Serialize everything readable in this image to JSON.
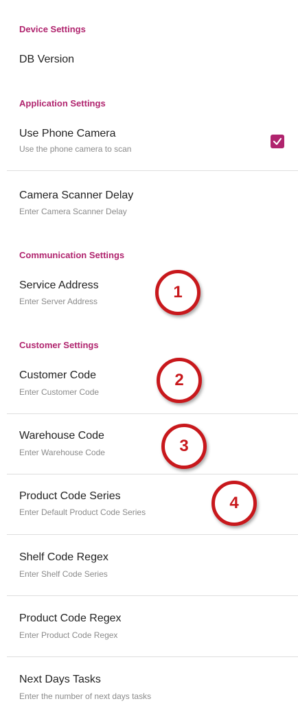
{
  "sections": {
    "device": "Device Settings",
    "application": "Application Settings",
    "communication": "Communication Settings",
    "customer": "Customer Settings"
  },
  "prefs": {
    "db_version": {
      "title": "DB Version"
    },
    "use_phone_camera": {
      "title": "Use Phone Camera",
      "summary": "Use the phone camera to scan",
      "checked": true
    },
    "camera_scanner_delay": {
      "title": "Camera Scanner Delay",
      "summary": "Enter Camera Scanner Delay"
    },
    "service_address": {
      "title": "Service Address",
      "summary": "Enter Server Address"
    },
    "customer_code": {
      "title": "Customer Code",
      "summary": "Enter Customer Code"
    },
    "warehouse_code": {
      "title": "Warehouse Code",
      "summary": "Enter Warehouse Code"
    },
    "product_code_series": {
      "title": "Product Code Series",
      "summary": "Enter Default Product Code Series"
    },
    "shelf_code_regex": {
      "title": "Shelf Code Regex",
      "summary": "Enter Shelf Code Series"
    },
    "product_code_regex": {
      "title": "Product Code Regex",
      "summary": "Enter Product Code Regex"
    },
    "next_days_tasks": {
      "title": "Next Days Tasks",
      "summary": "Enter the number of next days tasks"
    }
  },
  "annotations": [
    "1",
    "2",
    "3",
    "4"
  ],
  "colors": {
    "accent": "#b0246e",
    "annotation": "#c8181c"
  }
}
